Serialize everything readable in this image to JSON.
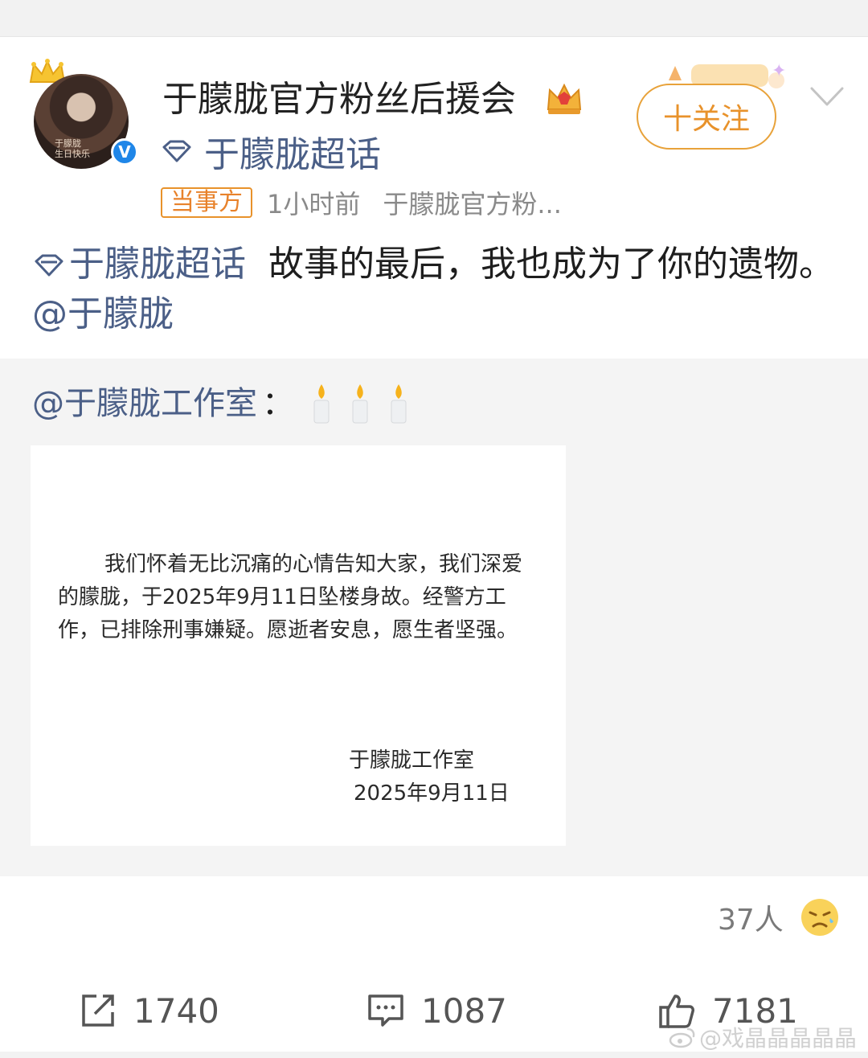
{
  "header": {
    "username": "于朦胧官方粉丝后援会",
    "chaohua_label": "于朦胧超话",
    "follow_label": "十关注",
    "tag": "当事方",
    "time": "1小时前",
    "source": "于朦胧官方粉..."
  },
  "avatar": {
    "caption": "于朦胧\n生日快乐",
    "verified_mark": "V"
  },
  "post": {
    "chaohua_link": "于朦胧超话",
    "text": "故事的最后，我也成为了你的遗物。",
    "mention": "@于朦胧"
  },
  "repost": {
    "mention": "@于朦胧工作室",
    "colon": "：",
    "notice_text": "我们怀着无比沉痛的心情告知大家，我们深爱的朦胧，于2025年9月11日坠楼身故。经警方工作，已排除刑事嫌疑。愿逝者安息，愿生者坚强。",
    "notice_signature": "于朦胧工作室",
    "notice_date": "2025年9月11日"
  },
  "reaction": {
    "count": "37人",
    "emoji": "sad-emoji"
  },
  "actions": {
    "share_count": "1740",
    "comment_count": "1087",
    "like_count": "7181"
  },
  "watermark": {
    "text": "@戏晶晶晶晶晶"
  },
  "colors": {
    "link": "#4b5f87",
    "follow_orange": "#e8922b",
    "muted": "#8a8a8a"
  }
}
